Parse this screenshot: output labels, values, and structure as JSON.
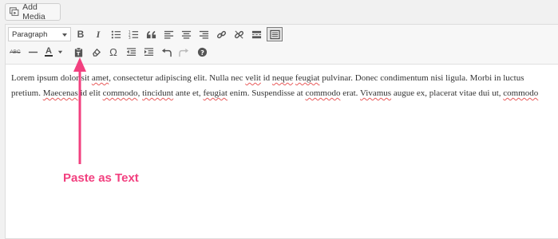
{
  "media": {
    "add_media_label": "Add Media"
  },
  "toolbar": {
    "format_select": "Paragraph",
    "row1_icons": [
      "bold-icon",
      "italic-icon",
      "bullet-list-icon",
      "numbered-list-icon",
      "blockquote-icon",
      "align-left-icon",
      "align-center-icon",
      "align-right-icon",
      "link-icon",
      "unlink-icon",
      "read-more-icon",
      "toolbar-toggle-icon"
    ],
    "row2_icons": [
      "strikethrough-icon",
      "horizontal-line-icon",
      "text-color-icon",
      "paste-as-text-icon",
      "clear-formatting-icon",
      "special-character-icon",
      "outdent-icon",
      "indent-icon",
      "undo-icon",
      "redo-icon",
      "help-icon"
    ],
    "bold_glyph": "B",
    "italic_glyph": "I",
    "text_color_glyph": "A",
    "strike_glyph": "ABC",
    "omega_glyph": "Ω"
  },
  "content": {
    "line1_a": "Lorem ipsum dolor sit ",
    "line1_b": "amet",
    "line1_c": ", consectetur adipiscing elit. Nulla nec ",
    "line1_d": "velit",
    "line1_e": " id ",
    "line1_f": "neque",
    "line1_g": " ",
    "line1_h": "feugiat",
    "line1_i": " pulvinar. Donec condimentum nisi ligula. Morbi in luctus",
    "line2_a": "pretium. ",
    "line2_b": "Maecenas",
    "line2_c": " id elit ",
    "line2_d": "commodo",
    "line2_e": ", ",
    "line2_f": "tincidunt",
    "line2_g": " ante et, ",
    "line2_h": "feugiat",
    "line2_i": " enim. Suspendisse at ",
    "line2_j": "commodo",
    "line2_k": " erat. ",
    "line2_l": "Vivamus",
    "line2_m": " augue ex, placerat vitae dui ut, ",
    "line2_n": "commodo"
  },
  "annotation": {
    "label": "Paste as Text",
    "color": "#f2407f"
  }
}
